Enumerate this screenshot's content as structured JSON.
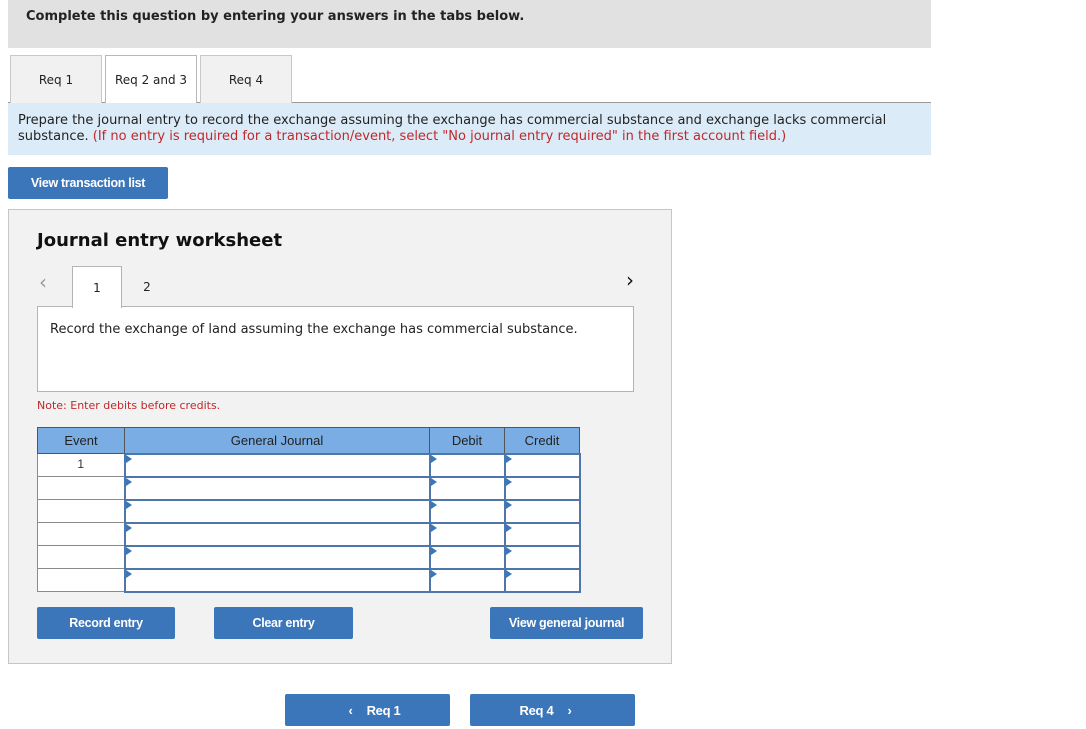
{
  "instruction": "Complete this question by entering your answers in the tabs below.",
  "tabs": [
    {
      "label": "Req 1",
      "active": false
    },
    {
      "label": "Req 2 and 3",
      "active": true
    },
    {
      "label": "Req 4",
      "active": false
    }
  ],
  "prompt": {
    "text": "Prepare the journal entry to record the exchange assuming the exchange has commercial substance and exchange lacks commercial substance.",
    "hint": "(If no entry is required for a transaction/event, select \"No journal entry required\" in the first account field.)"
  },
  "view_transaction_list_label": "View transaction list",
  "worksheet": {
    "title": "Journal entry worksheet",
    "prev_icon": "chevron-left-icon",
    "next_icon": "chevron-right-icon",
    "prev_glyph": "‹",
    "next_glyph": "›",
    "entry_tabs": [
      {
        "label": "1",
        "active": true
      },
      {
        "label": "2",
        "active": false
      }
    ],
    "description": "Record the exchange of land assuming the exchange has commercial substance.",
    "note": "Note: Enter debits before credits.",
    "table": {
      "headers": {
        "event": "Event",
        "general_journal": "General Journal",
        "debit": "Debit",
        "credit": "Credit"
      },
      "rows": [
        {
          "event": "1",
          "account": "",
          "debit": "",
          "credit": ""
        },
        {
          "event": "",
          "account": "",
          "debit": "",
          "credit": ""
        },
        {
          "event": "",
          "account": "",
          "debit": "",
          "credit": ""
        },
        {
          "event": "",
          "account": "",
          "debit": "",
          "credit": ""
        },
        {
          "event": "",
          "account": "",
          "debit": "",
          "credit": ""
        },
        {
          "event": "",
          "account": "",
          "debit": "",
          "credit": ""
        }
      ]
    },
    "buttons": {
      "record": "Record entry",
      "clear": "Clear entry",
      "view_general_journal": "View general journal"
    }
  },
  "nav": {
    "prev_label": "Req 1",
    "next_label": "Req 4",
    "prev_glyph": "‹",
    "next_glyph": "›"
  },
  "colors": {
    "button_blue": "#3a76b9",
    "table_header_blue": "#7aade3",
    "prompt_bg": "#dbecf8",
    "hint_red": "#c0282a"
  }
}
